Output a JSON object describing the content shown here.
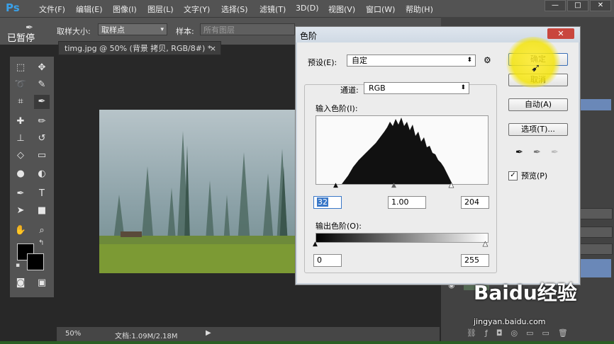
{
  "app": {
    "logo": "Ps",
    "menu": [
      "文件(F)",
      "编辑(E)",
      "图像(I)",
      "图层(L)",
      "文字(Y)",
      "选择(S)",
      "滤镜(T)",
      "3D(D)",
      "视图(V)",
      "窗口(W)",
      "帮助(H)"
    ],
    "window_buttons": [
      "—",
      "□",
      "✕"
    ]
  },
  "overlay": {
    "paused": "已暂停",
    "watermark_brand": "Baidu经验",
    "watermark_url": "jingyan.baidu.com"
  },
  "options_bar": {
    "sample_size_label": "取样大小:",
    "sample_size_value": "取样点",
    "sample_label": "样本:",
    "sample_value": "所有图层"
  },
  "document": {
    "tab_title": "timg.jpg @ 50% (背景 拷贝, RGB/8#) *",
    "tab_close": "×",
    "zoom": "50%",
    "doc_info": "文档:1.09M/2.18M"
  },
  "dialog": {
    "title": "色阶",
    "close": "✕",
    "preset_label": "预设(E):",
    "preset_value": "自定",
    "channel_label": "通道:",
    "channel_value": "RGB",
    "input_levels_label": "输入色阶(I):",
    "input_black": "32",
    "input_mid": "1.00",
    "input_white": "204",
    "output_levels_label": "输出色阶(O):",
    "output_black": "0",
    "output_white": "255",
    "ok_button": "确定",
    "cancel_button": "取消",
    "auto_button": "自动(A)",
    "options_button": "选项(T)...",
    "preview_label": "预览(P)",
    "preview_checked": true
  },
  "colors": {
    "menubar": "#535353",
    "highlight": "#f4e40a",
    "dialog_bg": "#ececec"
  }
}
